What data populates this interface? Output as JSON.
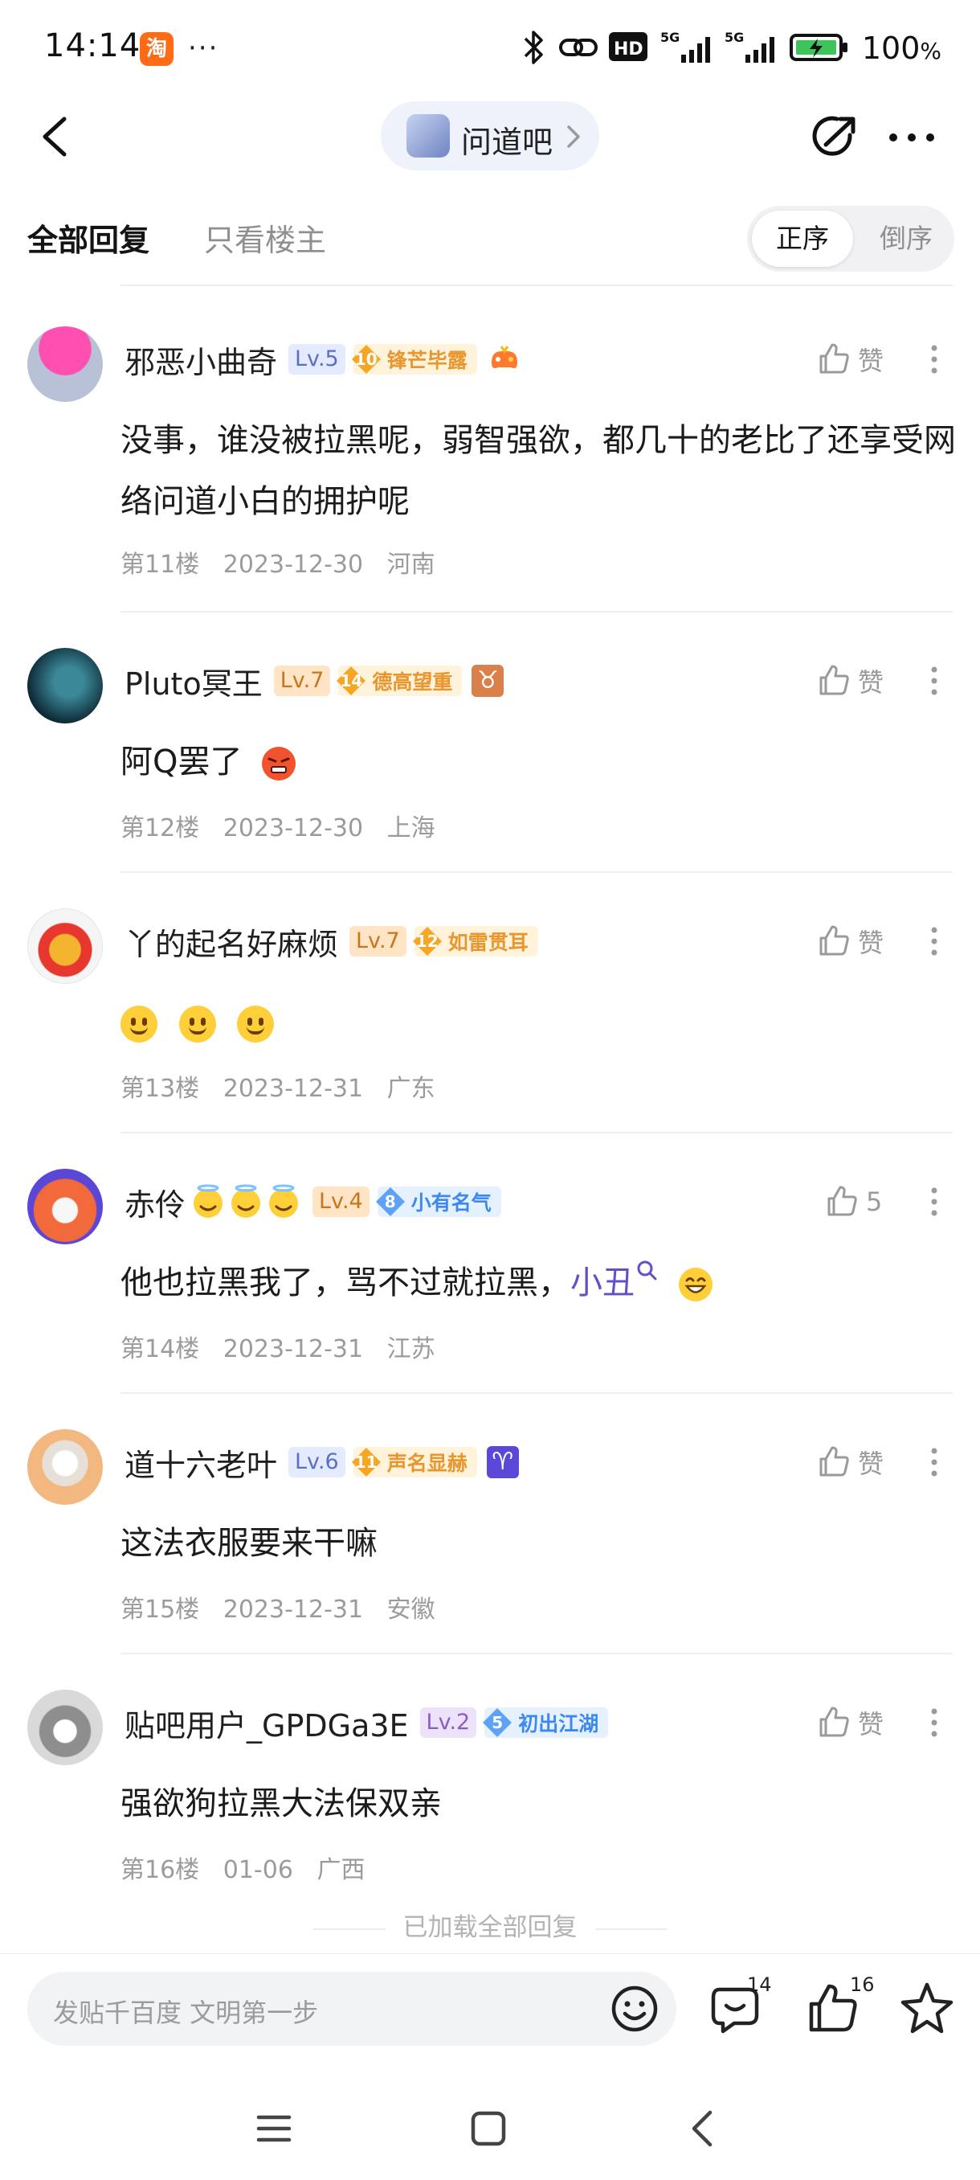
{
  "status_bar": {
    "time": "14:14",
    "app_icon_text": "淘",
    "more": "···",
    "network": "5G",
    "battery": "100",
    "battery_unit": "%"
  },
  "nav": {
    "forum_name": "问道吧"
  },
  "tabs": {
    "all_replies": "全部回复",
    "owner_only": "只看楼主",
    "order_asc": "正序",
    "order_desc": "倒序"
  },
  "comments": [
    {
      "username": "邪恶小曲奇",
      "level": "Lv.5",
      "honor_level": "10",
      "honor_title": "锋芒毕露",
      "text": "没事，谁没被拉黑呢，弱智强欲，都几十的老比了还享受网络问道小白的拥护呢",
      "floor": "第11楼",
      "date": "2023-12-30",
      "location": "河南",
      "like_label": "赞"
    },
    {
      "username": "Pluto冥王",
      "level": "Lv.7",
      "honor_level": "14",
      "honor_title": "德高望重",
      "zodiac": "♉",
      "text": "阿Q罢了",
      "floor": "第12楼",
      "date": "2023-12-30",
      "location": "上海",
      "like_label": "赞"
    },
    {
      "username": "丫的起名好麻烦",
      "level": "Lv.7",
      "honor_level": "12",
      "honor_title": "如雷贯耳",
      "text": "",
      "floor": "第13楼",
      "date": "2023-12-31",
      "location": "广东",
      "like_label": "赞"
    },
    {
      "username": "赤伶",
      "level": "Lv.4",
      "honor_level": "8",
      "honor_title": "小有名气",
      "text": "他也拉黑我了，骂不过就拉黑，",
      "link_text": "小丑",
      "floor": "第14楼",
      "date": "2023-12-31",
      "location": "江苏",
      "like_label": "5"
    },
    {
      "username": "道十六老叶",
      "level": "Lv.6",
      "honor_level": "11",
      "honor_title": "声名显赫",
      "zodiac": "♈",
      "text": "这法衣服要来干嘛",
      "floor": "第15楼",
      "date": "2023-12-31",
      "location": "安徽",
      "like_label": "赞"
    },
    {
      "username": "贴吧用户_GPDGa3E",
      "level": "Lv.2",
      "honor_level": "5",
      "honor_title": "初出江湖",
      "text": "强欲狗拉黑大法保双亲",
      "floor": "第16楼",
      "date": "01-06",
      "location": "广西",
      "like_label": "赞"
    }
  ],
  "footer": {
    "all_loaded": "已加载全部回复",
    "input_placeholder": "发贴千百度 文明第一步",
    "reply_count": "14",
    "like_count": "16"
  },
  "colors": {
    "accent_purple": "#6150c8",
    "honor_gold": "#e8962d",
    "honor_blue": "#3d88ec"
  }
}
